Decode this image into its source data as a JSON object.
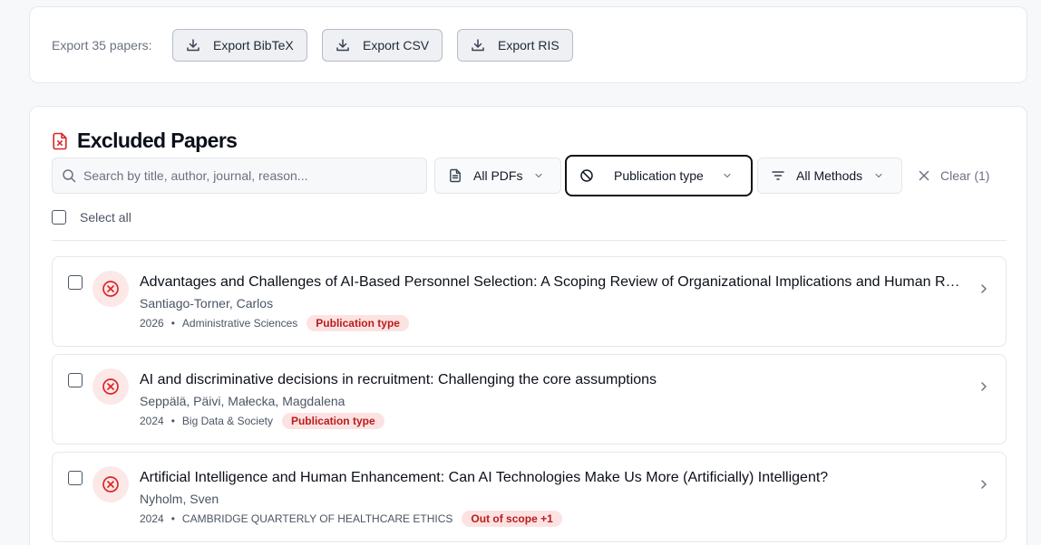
{
  "export": {
    "label": "Export 35 papers:",
    "buttons": [
      {
        "label": "Export BibTeX",
        "icon": "download-icon"
      },
      {
        "label": "Export CSV",
        "icon": "download-icon"
      },
      {
        "label": "Export RIS",
        "icon": "download-icon"
      }
    ]
  },
  "excluded": {
    "title": "Excluded Papers",
    "title_icon": "file-x-icon",
    "search_placeholder": "Search by title, author, journal, reason...",
    "filters": {
      "pdfs": "All PDFs",
      "publication": "Publication type",
      "methods": "All Methods"
    },
    "clear_label": "Clear (1)",
    "select_all": "Select all",
    "papers": [
      {
        "title": "Advantages and Challenges of AI-Based Personnel Selection: A Scoping Review of Organizational Implications and Human Resource Management",
        "authors": "Santiago-Torner, Carlos",
        "year": "2026",
        "journal": "Administrative Sciences",
        "tag": "Publication type"
      },
      {
        "title": "AI and discriminative decisions in recruitment: Challenging the core assumptions",
        "authors": "Seppälä, Päivi, Małecka, Magdalena",
        "year": "2024",
        "journal": "Big Data & Society",
        "tag": "Publication type"
      },
      {
        "title": "Artificial Intelligence and Human Enhancement: Can AI Technologies Make Us More (Artificially) Intelligent?",
        "authors": "Nyholm, Sven",
        "year": "2024",
        "journal": "CAMBRIDGE QUARTERLY OF HEALTHCARE ETHICS",
        "tag": "Out of scope +1"
      }
    ]
  },
  "colors": {
    "accent_red": "#dc2626",
    "tag_bg": "#fde2e2",
    "tag_text": "#b91c1c"
  }
}
